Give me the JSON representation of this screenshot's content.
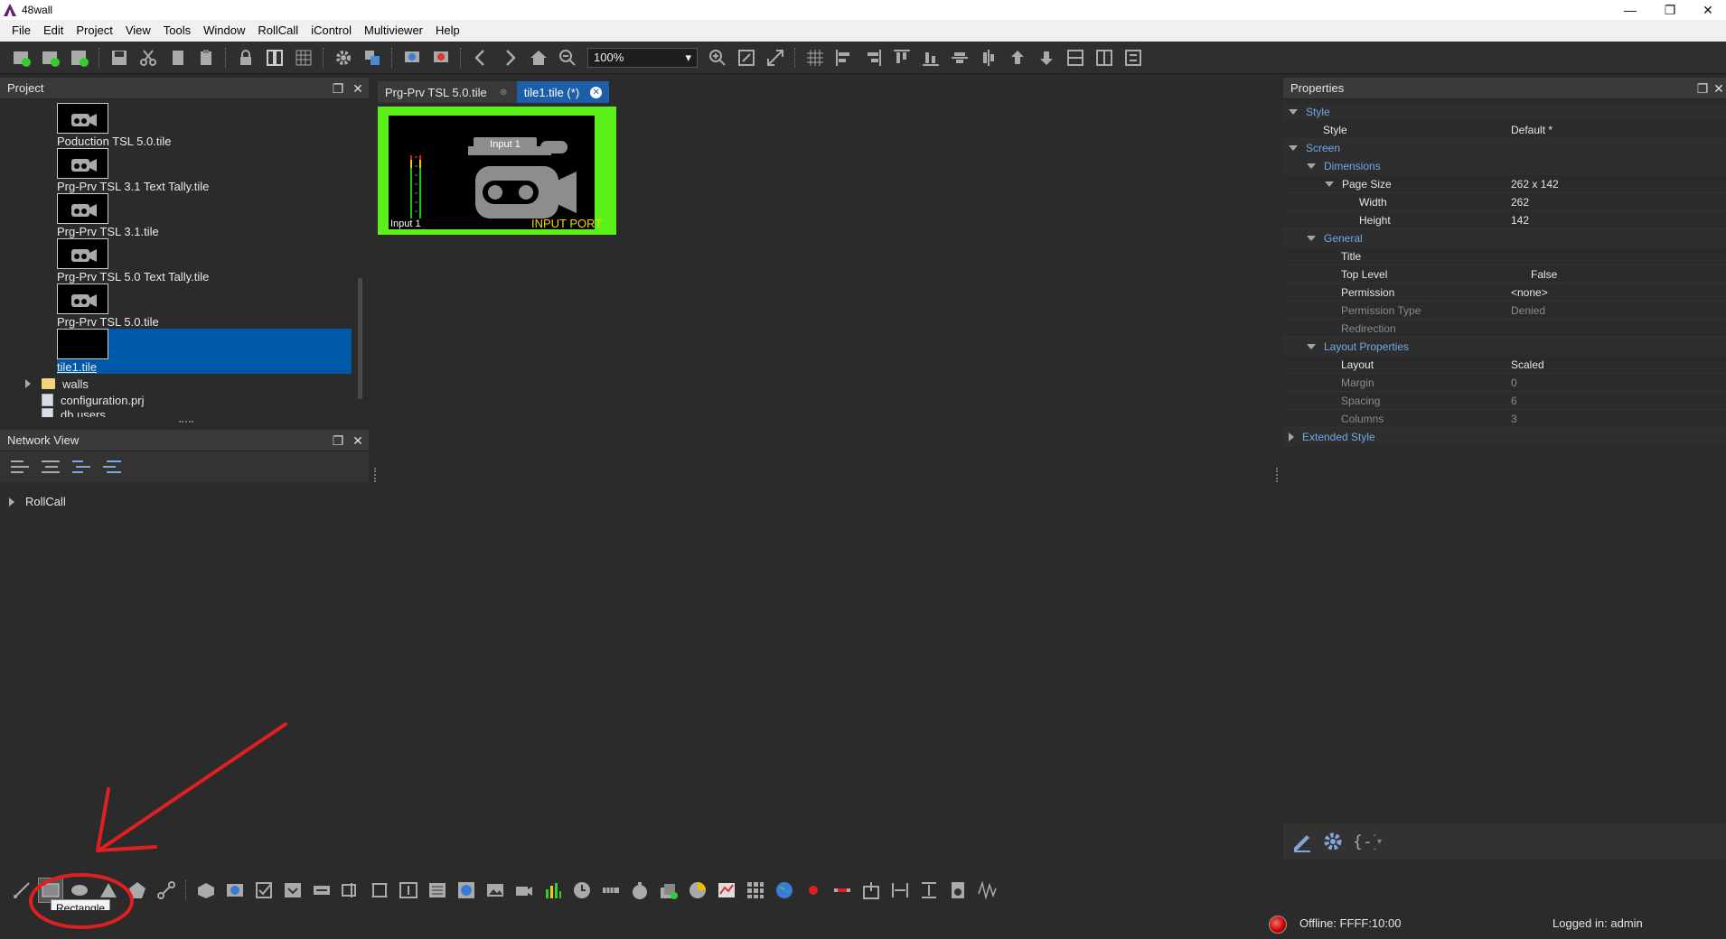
{
  "window": {
    "title": "48wall",
    "controls": [
      "—",
      "❐",
      "✕"
    ]
  },
  "menu": [
    "File",
    "Edit",
    "Project",
    "View",
    "Tools",
    "Window",
    "RollCall",
    "iControl",
    "Multiviewer",
    "Help"
  ],
  "toolbar": {
    "zoom": "100%"
  },
  "project_panel": {
    "title": "Project",
    "tiles": [
      {
        "label": "Poduction TSL 5.0.tile"
      },
      {
        "label": "Prg-Prv TSL 3.1 Text Tally.tile"
      },
      {
        "label": "Prg-Prv TSL 3.1.tile"
      },
      {
        "label": "Prg-Prv TSL 5.0 Text Tally.tile"
      },
      {
        "label": "Prg-Prv TSL 5.0.tile"
      },
      {
        "label": "tile1.tile"
      }
    ],
    "tree": {
      "walls": "walls",
      "configuration": "configuration.prj",
      "db_users": "db.users"
    }
  },
  "network_panel": {
    "title": "Network View",
    "root": "RollCall"
  },
  "tabs": [
    {
      "label": "Prg-Prv TSL 5.0.tile"
    },
    {
      "label": "tile1.tile (*)"
    }
  ],
  "canvas": {
    "input_box": "Input 1",
    "input_label": "Input 1",
    "port_label": "INPUT PORT"
  },
  "properties": {
    "title": "Properties",
    "rows": [
      {
        "name": "Style",
        "value": ""
      },
      {
        "name": "Style",
        "value": "Default *"
      },
      {
        "name": "Screen",
        "value": ""
      },
      {
        "name": "Dimensions",
        "value": ""
      },
      {
        "name": "Page Size",
        "value": "262 x 142"
      },
      {
        "name": "Width",
        "value": "262"
      },
      {
        "name": "Height",
        "value": "142"
      },
      {
        "name": "General",
        "value": ""
      },
      {
        "name": "Title",
        "value": ""
      },
      {
        "name": "Top Level",
        "value": "False"
      },
      {
        "name": "Permission",
        "value": "<none>"
      },
      {
        "name": "Permission Type",
        "value": "Denied"
      },
      {
        "name": "Redirection",
        "value": ""
      },
      {
        "name": "Layout Properties",
        "value": ""
      },
      {
        "name": "Layout",
        "value": "Scaled"
      },
      {
        "name": "Margin",
        "value": "0"
      },
      {
        "name": "Spacing",
        "value": "6"
      },
      {
        "name": "Columns",
        "value": "3"
      },
      {
        "name": "Extended Style",
        "value": ""
      }
    ]
  },
  "tooltip": "Rectangle",
  "status": {
    "connection": "Offline: FFFF:10:00",
    "login": "Logged in: admin"
  },
  "colors": {
    "accent": "#0058a8",
    "tile_border": "#5cf01a",
    "port_label": "#f2d600",
    "annotation": "#e02020"
  }
}
